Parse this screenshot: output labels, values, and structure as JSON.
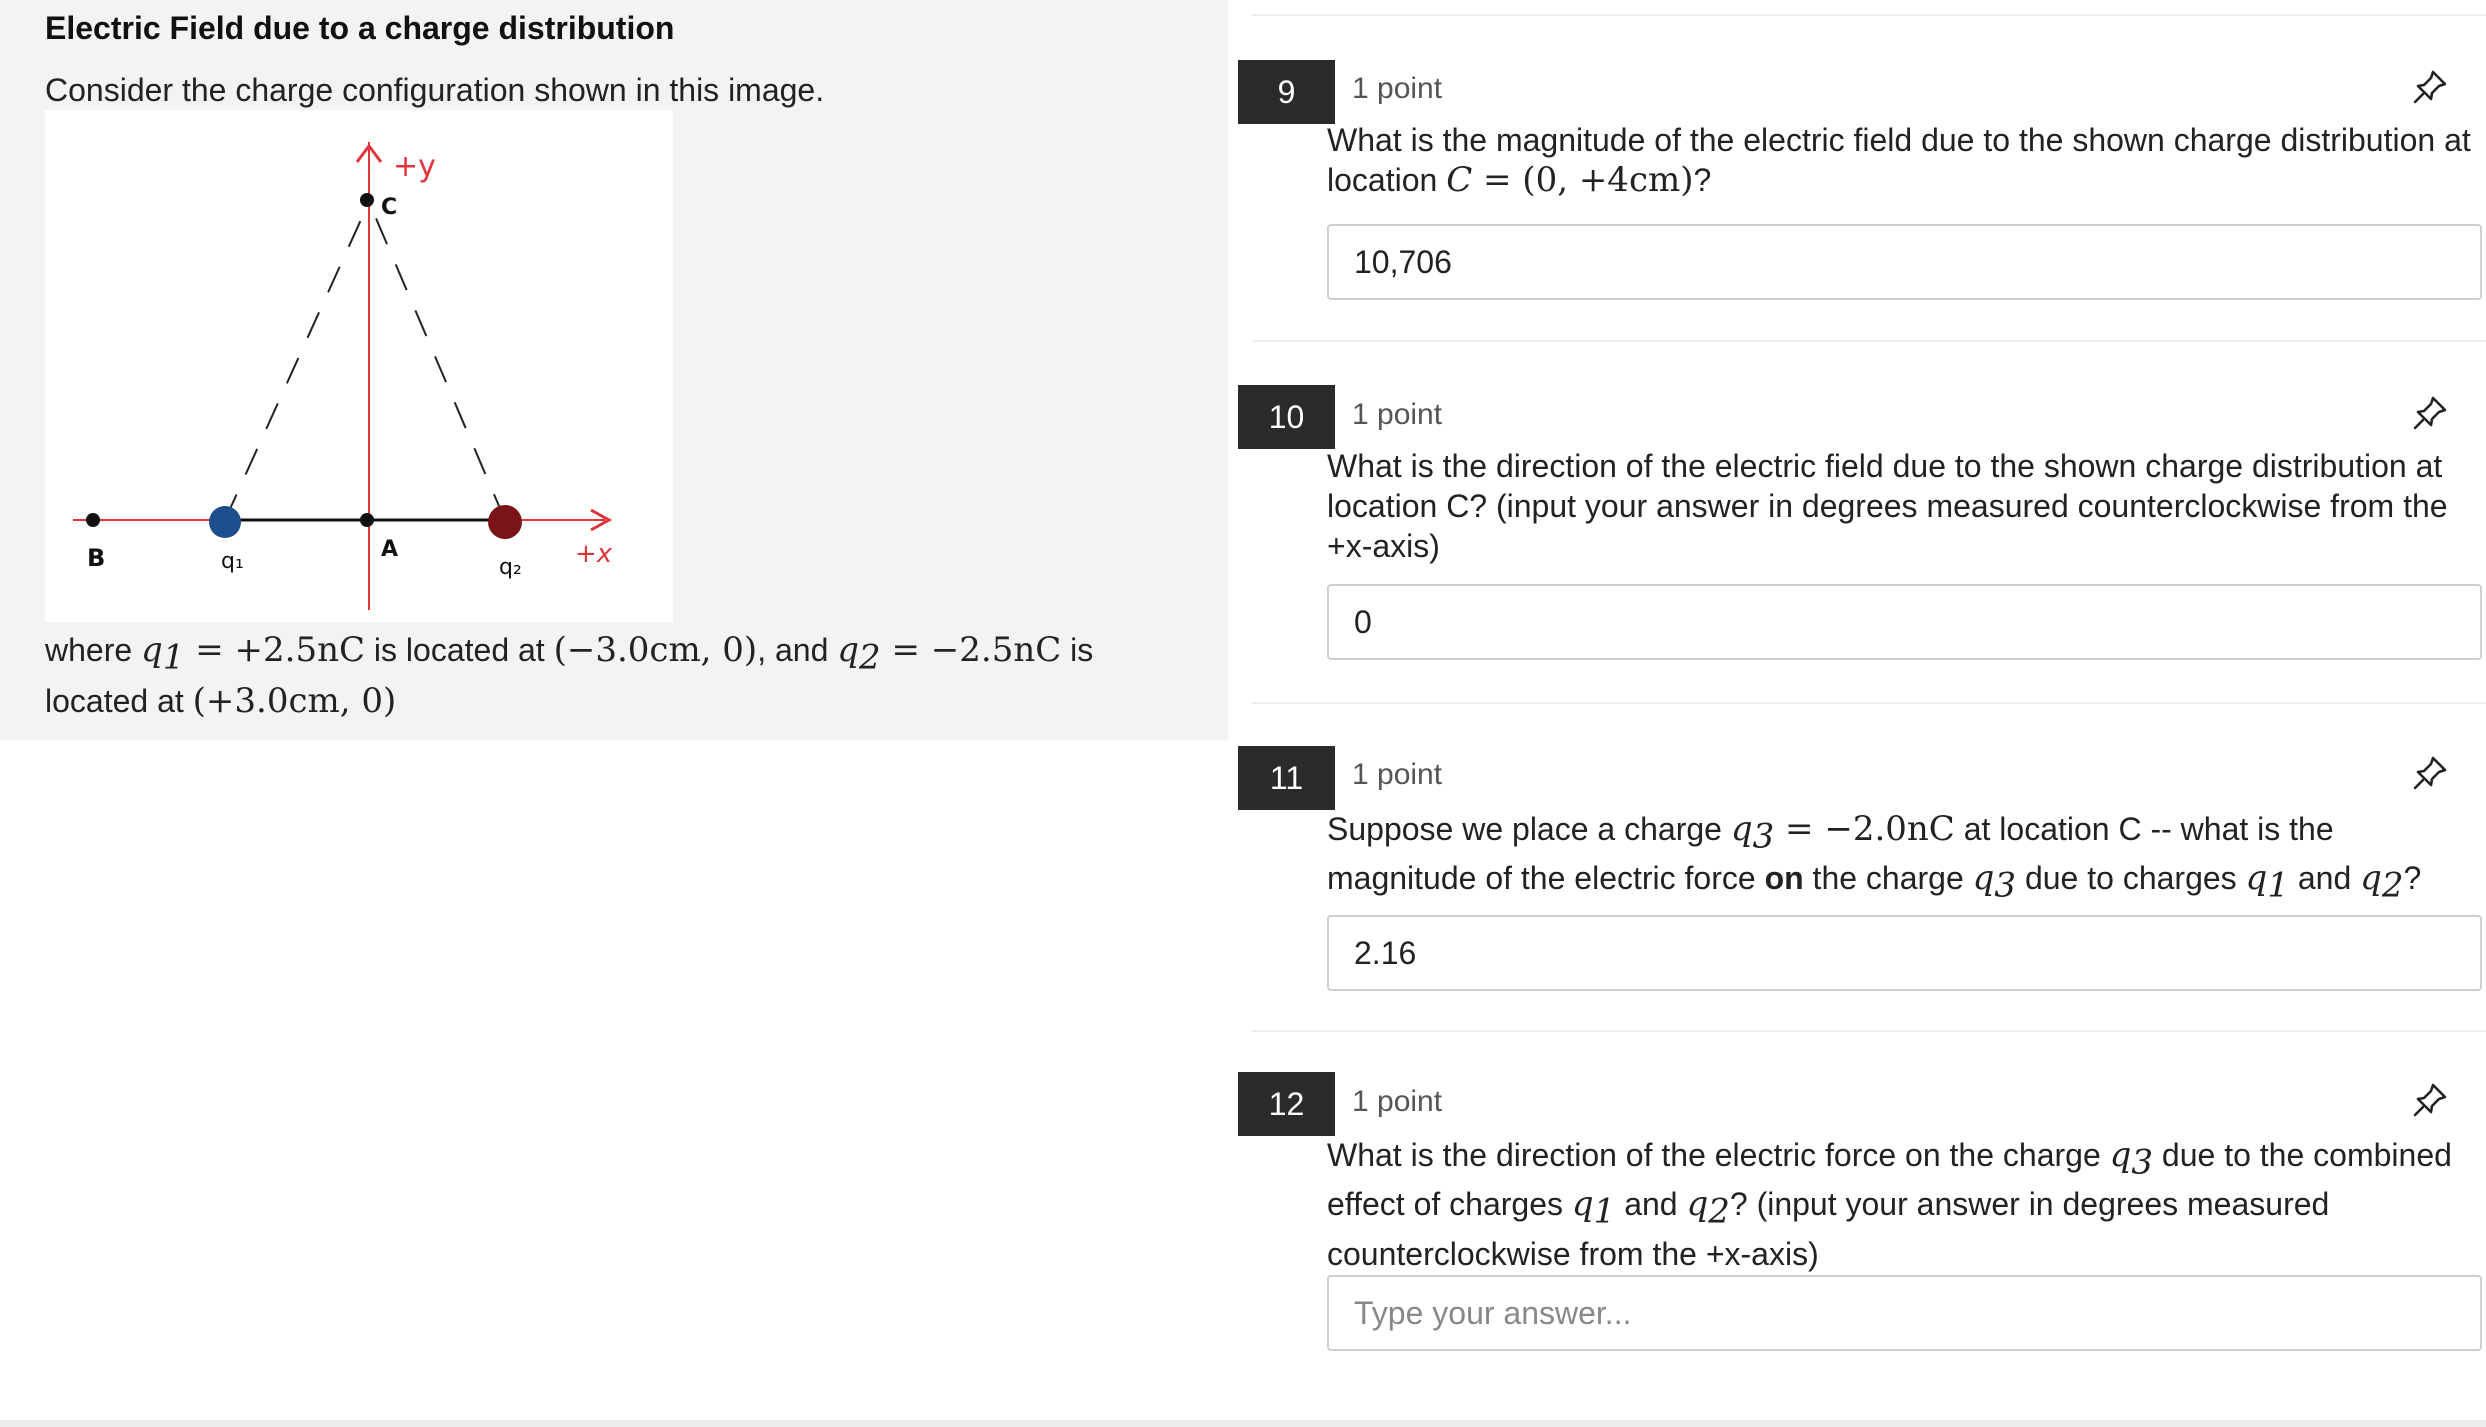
{
  "left": {
    "title": "Electric Field due to a charge distribution",
    "intro": "Consider the charge configuration shown in this image.",
    "figure": {
      "label_plus_y": "+y",
      "label_C": "C",
      "label_A": "A",
      "label_B": "B",
      "label_q1": "q₁",
      "label_q2": "q₂",
      "label_plus_x": "+x",
      "q1_color": "#1f4e8c",
      "q2_color": "#7a1416",
      "axis_color": "#e0353b"
    },
    "where": {
      "t1": "where",
      "q1": "q",
      "q1_sub": "1",
      "eq1": " = +2.5nC",
      "t2": "is located at",
      "loc1": "(−3.0cm, 0)",
      "t3": ", and",
      "q2": "q",
      "q2_sub": "2",
      "eq2": " = −2.5nC",
      "t4": "is located at",
      "loc2": "(+3.0cm, 0)"
    }
  },
  "questions": [
    {
      "number": "9",
      "points": "1 point",
      "text_a": "What is the magnitude of the electric field due to the shown charge distribution at location ",
      "text_math": "C",
      "text_b": " = (0, +4cm)",
      "text_c": "?",
      "answer": "10,706",
      "is_placeholder": false
    },
    {
      "number": "10",
      "points": "1 point",
      "text": "What is the direction of the electric field due to the shown charge distribution at location C? (input your answer in degrees measured counterclockwise from the +x-axis)",
      "answer": "0",
      "is_placeholder": false
    },
    {
      "number": "11",
      "points": "1 point",
      "text_a": "Suppose we place a charge ",
      "q3": "q",
      "q3_sub": "3",
      "q3_val": " = −2.0nC",
      "text_b": " at location C -- what is the magnitude of the electric force ",
      "bold_on": "on",
      "text_c": " the charge ",
      "text_d": " due to charges ",
      "text_e": " and ",
      "text_f": "?",
      "answer": "2.16",
      "is_placeholder": false
    },
    {
      "number": "12",
      "points": "1 point",
      "text_a": "What is the direction of the electric force on the charge ",
      "text_b": " due to the combined effect of charges ",
      "text_c": " and ",
      "text_d": "? (input your answer in degrees measured counterclockwise from the +x-axis)",
      "answer": "Type your answer...",
      "is_placeholder": true
    }
  ]
}
